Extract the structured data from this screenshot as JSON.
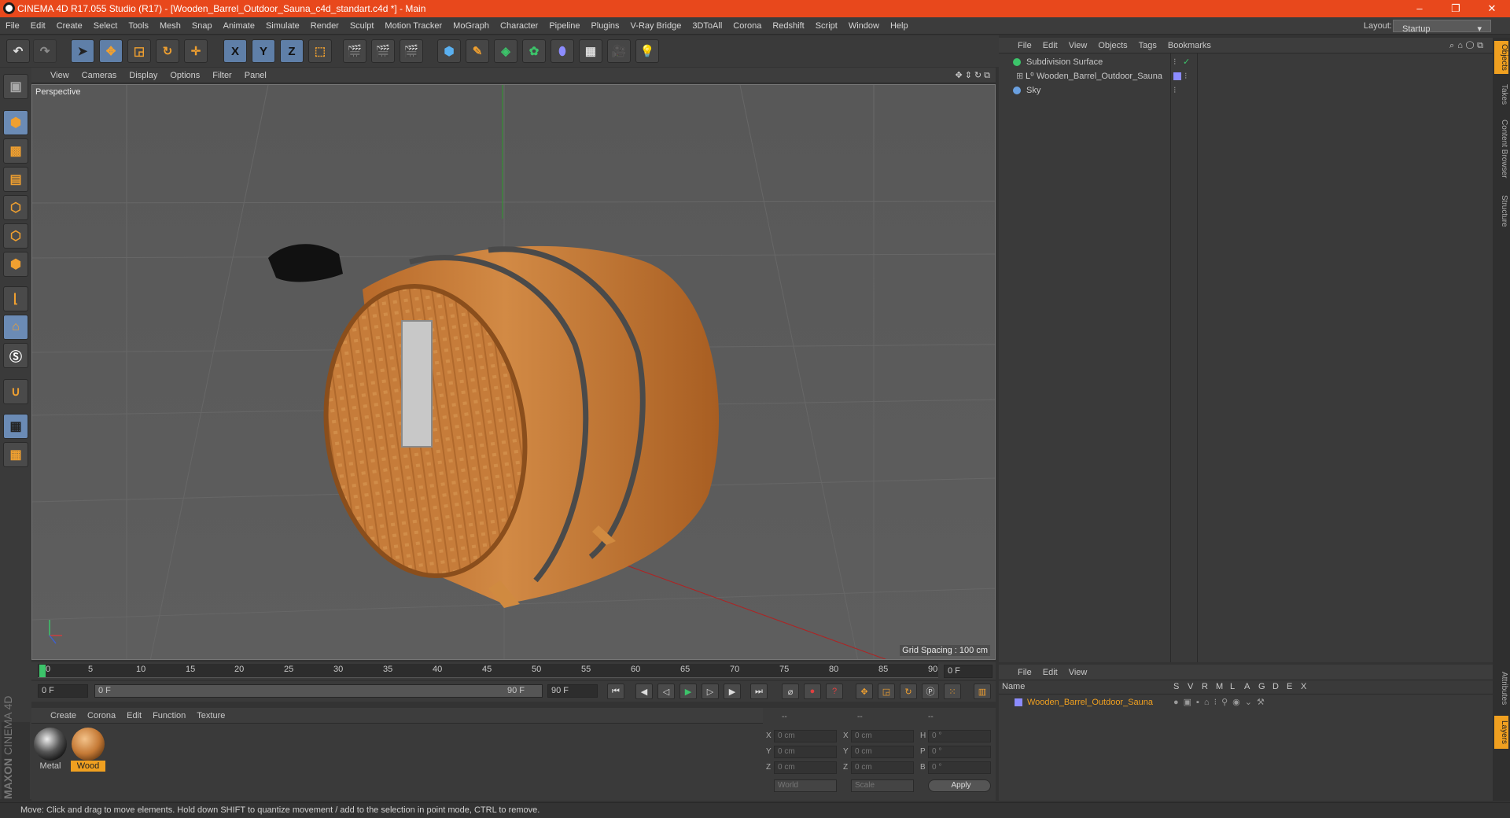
{
  "window": {
    "title": "CINEMA 4D R17.055 Studio (R17) - [Wooden_Barrel_Outdoor_Sauna_c4d_standart.c4d *] - Main",
    "controls": [
      "–",
      "❐",
      "✕"
    ]
  },
  "menubar": {
    "items": [
      "File",
      "Edit",
      "Create",
      "Select",
      "Tools",
      "Mesh",
      "Snap",
      "Animate",
      "Simulate",
      "Render",
      "Sculpt",
      "Motion Tracker",
      "MoGraph",
      "Character",
      "Pipeline",
      "Plugins",
      "V-Ray Bridge",
      "3DToAll",
      "Corona",
      "Redshift",
      "Script",
      "Window",
      "Help"
    ],
    "layout_label": "Layout:",
    "layout_value": "Startup"
  },
  "toolbar": {
    "axis_x": "X",
    "axis_y": "Y",
    "axis_z": "Z"
  },
  "viewport": {
    "menu": [
      "View",
      "Cameras",
      "Display",
      "Options",
      "Filter",
      "Panel"
    ],
    "label": "Perspective",
    "grid_spacing": "Grid Spacing : 100 cm"
  },
  "timeline": {
    "ticks": [
      "0",
      "5",
      "10",
      "15",
      "20",
      "25",
      "30",
      "35",
      "40",
      "45",
      "50",
      "55",
      "60",
      "65",
      "70",
      "75",
      "80",
      "85",
      "90"
    ],
    "current_frame": "0 F"
  },
  "controls": {
    "start_field": "0 F",
    "slider_start": "0 F",
    "slider_end": "90 F",
    "end_field": "90 F"
  },
  "materials": {
    "menu": [
      "Create",
      "Corona",
      "Edit",
      "Function",
      "Texture"
    ],
    "items": [
      {
        "name": "Metal",
        "selected": false
      },
      {
        "name": "Wood",
        "selected": true
      }
    ]
  },
  "coordinates": {
    "headers": [
      "--",
      "--",
      "--"
    ],
    "rows": [
      {
        "a": "X",
        "av": "0 cm",
        "b": "X",
        "bv": "0 cm",
        "c": "H",
        "cv": "0 °"
      },
      {
        "a": "Y",
        "av": "0 cm",
        "b": "Y",
        "bv": "0 cm",
        "c": "P",
        "cv": "0 °"
      },
      {
        "a": "Z",
        "av": "0 cm",
        "b": "Z",
        "bv": "0 cm",
        "c": "B",
        "cv": "0 °"
      }
    ],
    "mode1": "World",
    "mode2": "Scale",
    "apply": "Apply"
  },
  "objects": {
    "menu": [
      "File",
      "Edit",
      "View",
      "Objects",
      "Tags",
      "Bookmarks"
    ],
    "items": [
      {
        "name": "Subdivision Surface",
        "color": "#3cc46a"
      },
      {
        "name": "Wooden_Barrel_Outdoor_Sauna",
        "color": "#8c8cff"
      },
      {
        "name": "Sky",
        "color": "#6aa0e0"
      }
    ]
  },
  "layers": {
    "menu": [
      "File",
      "Edit",
      "View"
    ],
    "columns": [
      "Name",
      "S",
      "V",
      "R",
      "M",
      "L",
      "A",
      "G",
      "D",
      "E",
      "X"
    ],
    "items": [
      {
        "name": "Wooden_Barrel_Outdoor_Sauna"
      }
    ]
  },
  "side_tabs": [
    "Objects",
    "Takes",
    "Content Browser",
    "Structure"
  ],
  "side_tabs_bottom": [
    "Attributes",
    "Layers"
  ],
  "brand": {
    "text1": "MAXON",
    "text2": "CINEMA 4D"
  },
  "status": "Move: Click and drag to move elements. Hold down SHIFT to quantize movement / add to the selection in point mode, CTRL to remove."
}
